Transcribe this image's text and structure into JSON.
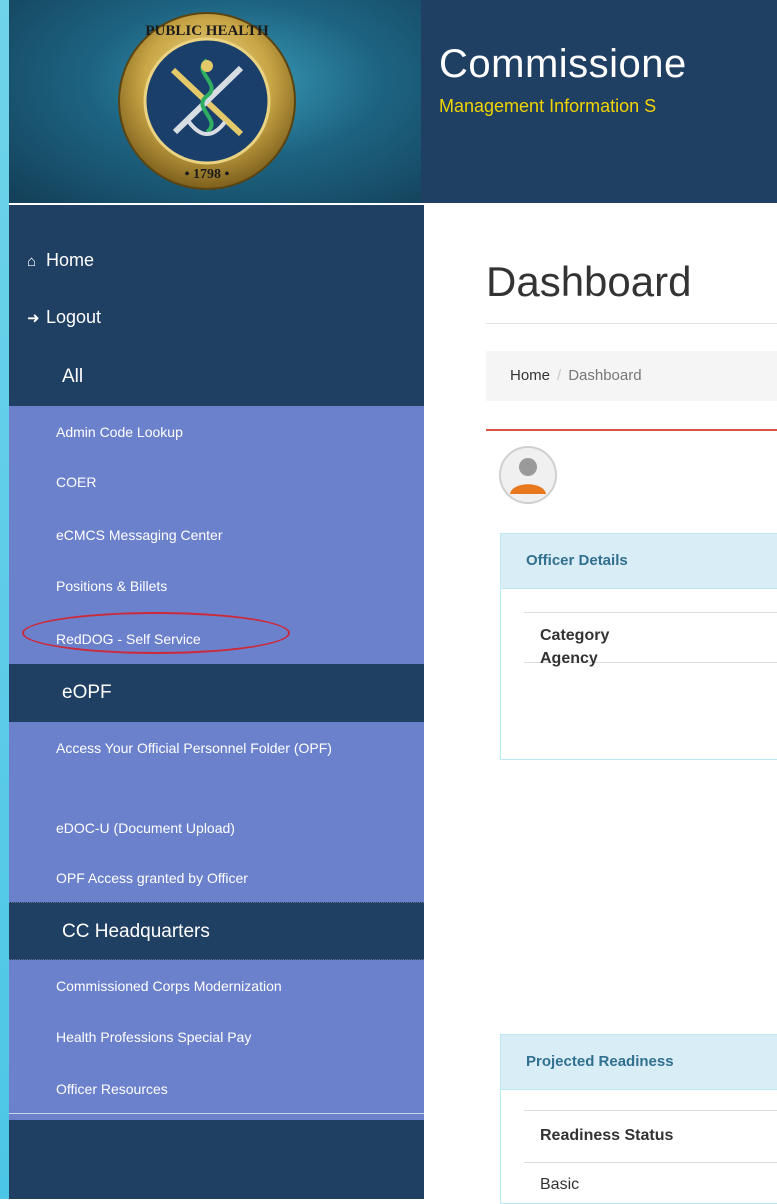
{
  "header": {
    "title": "Commissione",
    "subtitle": "Management Information S"
  },
  "sidebar": {
    "top_links": [
      {
        "label": "Home",
        "icon": "home-icon"
      },
      {
        "label": "Logout",
        "icon": "logout-icon"
      }
    ],
    "sections": [
      {
        "title": "All",
        "items": [
          "Admin Code Lookup",
          "COER",
          "eCMCS Messaging Center",
          "Positions & Billets",
          "RedDOG - Self Service"
        ]
      },
      {
        "title": "eOPF",
        "items": [
          "Access Your Official Personnel Folder (OPF)",
          "eDOC-U (Document Upload)",
          "OPF Access granted by Officer"
        ]
      },
      {
        "title": "CC Headquarters",
        "items": [
          "Commissioned Corps Modernization",
          "Health Professions Special Pay",
          "Officer Resources"
        ]
      }
    ]
  },
  "main": {
    "page_title": "Dashboard",
    "breadcrumb": {
      "home": "Home",
      "separator": "/",
      "current": "Dashboard"
    },
    "officer_details": {
      "title": "Officer Details",
      "rows": [
        "Category",
        "Agency"
      ]
    },
    "projected_readiness": {
      "title": "Projected Readiness",
      "header": "Readiness Status",
      "rows": [
        "Basic"
      ]
    }
  },
  "colors": {
    "sidebar_bg": "#1f3f63",
    "submenu_bg": "#6c81cb",
    "subtitle_yellow": "#f2d400",
    "panel_head_bg": "#d9edf7",
    "panel_head_text": "#31708f",
    "accent_red": "#d9533f"
  }
}
